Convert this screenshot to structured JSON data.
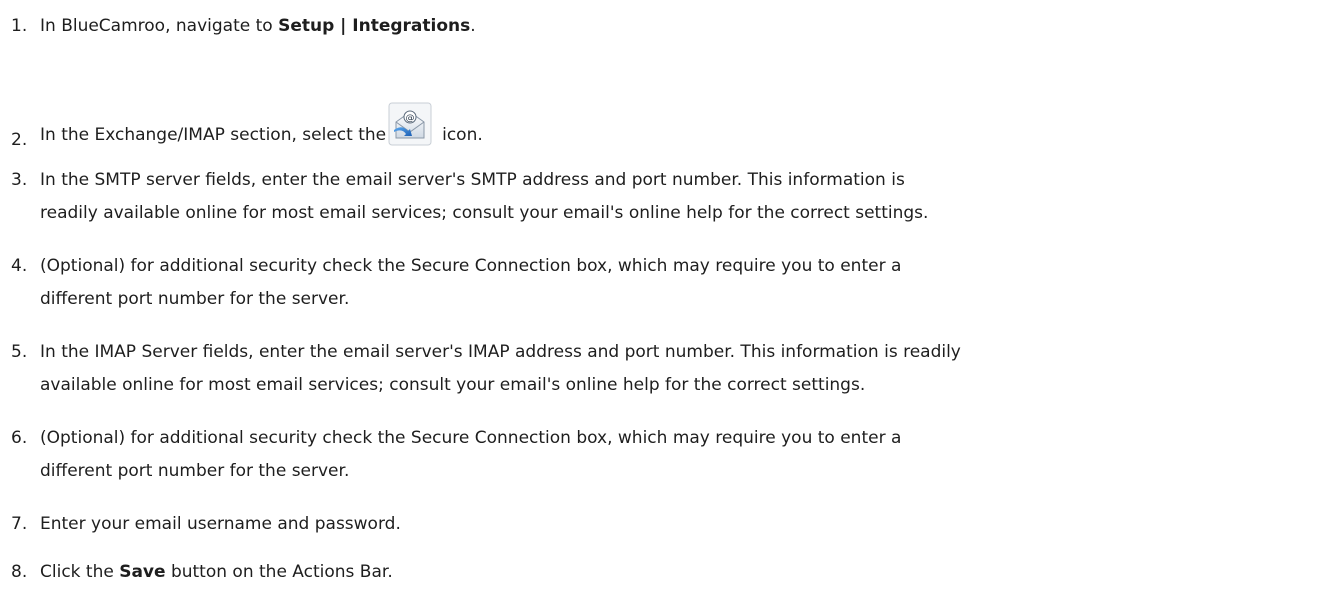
{
  "steps": [
    {
      "number": "1.",
      "prefix": "In BlueCamroo, navigate to ",
      "bold": "Setup | Integrations",
      "suffix": "."
    },
    {
      "number": "2.",
      "prefix": "In the Exchange/IMAP section, select the",
      "icon": "email-envelope-icon",
      "suffix": "icon."
    },
    {
      "number": "3.",
      "line1": "In the SMTP server fields, enter the email server's SMTP address and port number. This information is",
      "line2": "readily available online for most email services; consult your email's online help for the correct settings."
    },
    {
      "number": "4.",
      "line1": "(Optional) for additional security check the Secure Connection box, which may require you to enter a",
      "line2": "different port number for the server."
    },
    {
      "number": "5.",
      "line1": "In the IMAP Server fields, enter the email server's IMAP address and port number. This information is readily",
      "line2": "available online for most email services; consult your email's online help for the correct settings."
    },
    {
      "number": "6.",
      "line1": "(Optional) for additional security check the Secure Connection box, which may require you to enter a",
      "line2": "different port number for the server."
    },
    {
      "number": "7.",
      "text": "Enter your email username and password."
    },
    {
      "number": "8.",
      "prefix": "Click the ",
      "bold": "Save",
      "suffix": " button on the Actions Bar."
    }
  ],
  "colors": {
    "text": "#1e1e1e",
    "icon_blue": "#2f7fd6",
    "icon_envelope": "#e8eef5"
  }
}
